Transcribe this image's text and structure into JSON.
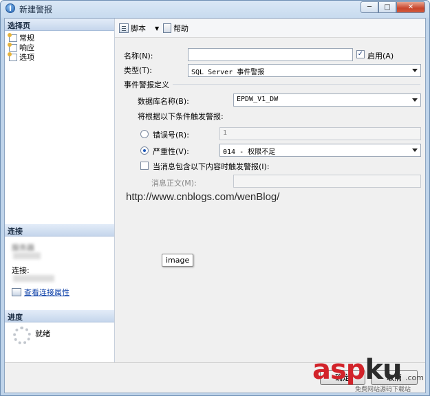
{
  "window": {
    "title": "新建警报",
    "controls": {
      "minimize": "─",
      "maximize": "□",
      "close": "✕"
    }
  },
  "left_pane": {
    "select_page_header": "选择页",
    "pages": [
      {
        "label": "常规",
        "icon": "page-icon"
      },
      {
        "label": "响应",
        "icon": "page-icon"
      },
      {
        "label": "选项",
        "icon": "page-icon"
      }
    ],
    "connection_header": "连接",
    "server_label": "服务器",
    "connection_label": "连接:",
    "view_connection_props": "查看连接属性",
    "progress_header": "进度",
    "progress_status": "就绪"
  },
  "toolbar": {
    "script_label": "脚本",
    "help_label": "帮助"
  },
  "form": {
    "name_label": "名称(N):",
    "name_value": "",
    "enable_label": "启用(A)",
    "enable_checked": true,
    "type_label": "类型(T):",
    "type_value": "SQL Server 事件警报",
    "section_title": "事件警报定义",
    "db_name_label": "数据库名称(B):",
    "db_name_value": "EPDW_V1_DW",
    "trigger_text": "将根据以下条件触发警报:",
    "error_number_label": "错误号(R):",
    "error_number_value": "1",
    "severity_label": "严重性(V):",
    "severity_value": "014 - 权限不足",
    "severity_selected": true,
    "message_contains_label": "当消息包含以下内容时触发警报(I):",
    "message_contains_checked": false,
    "message_text_label": "消息正文(M):",
    "message_text_value": ""
  },
  "overlay": {
    "url_watermark": "http://www.cnblogs.com/wenBlog/",
    "tooltip": "image"
  },
  "footer": {
    "ok_label": "确定",
    "cancel_label": "取消"
  },
  "logo": {
    "brand_red": "asp",
    "brand_dark": "ku",
    "domain_suffix": ".com",
    "tagline": "免费网站源码下载站",
    "red": "#d2232a"
  }
}
